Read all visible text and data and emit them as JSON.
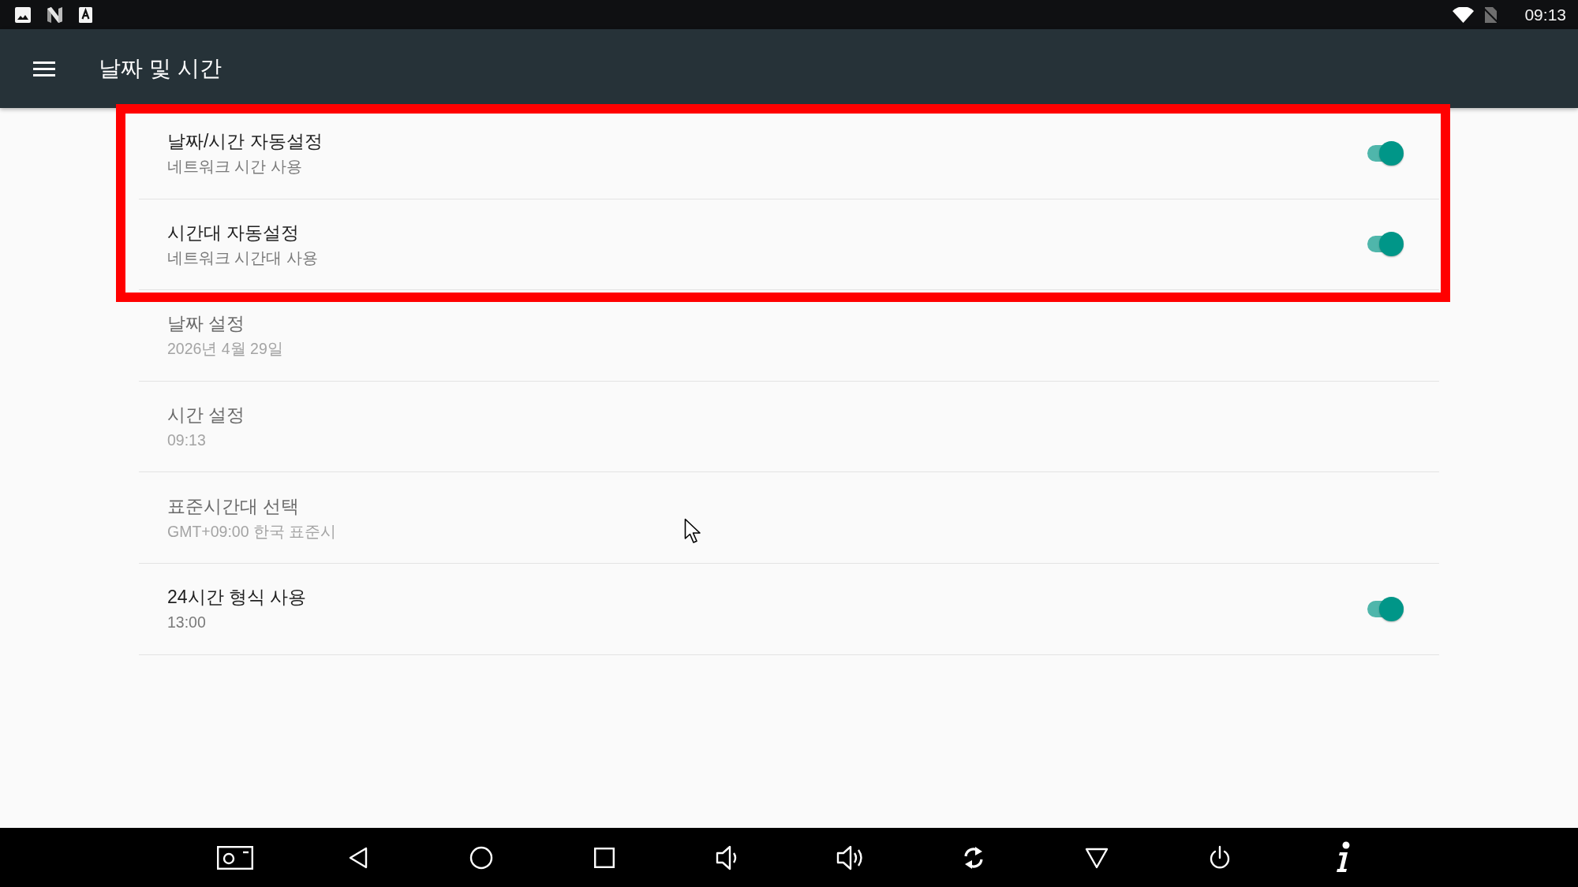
{
  "status_bar": {
    "time": "09:13"
  },
  "toolbar": {
    "title": "날짜 및 시간"
  },
  "settings": [
    {
      "kind": "switch",
      "title": "날짜/시간 자동설정",
      "summary": "네트워크 시간 사용",
      "on": true,
      "disabled": false,
      "highlighted": true
    },
    {
      "kind": "switch",
      "title": "시간대 자동설정",
      "summary": "네트워크 시간대 사용",
      "on": true,
      "disabled": false,
      "highlighted": true
    },
    {
      "kind": "entry",
      "title": "날짜 설정",
      "summary": "2026년 4월 29일",
      "disabled": true,
      "highlighted": false
    },
    {
      "kind": "entry",
      "title": "시간 설정",
      "summary": "09:13",
      "disabled": true,
      "highlighted": false
    },
    {
      "kind": "entry",
      "title": "표준시간대 선택",
      "summary": "GMT+09:00 한국 표준시",
      "disabled": true,
      "highlighted": false
    },
    {
      "kind": "switch",
      "title": "24시간 형식 사용",
      "summary": "13:00",
      "on": true,
      "disabled": false,
      "highlighted": false
    }
  ]
}
